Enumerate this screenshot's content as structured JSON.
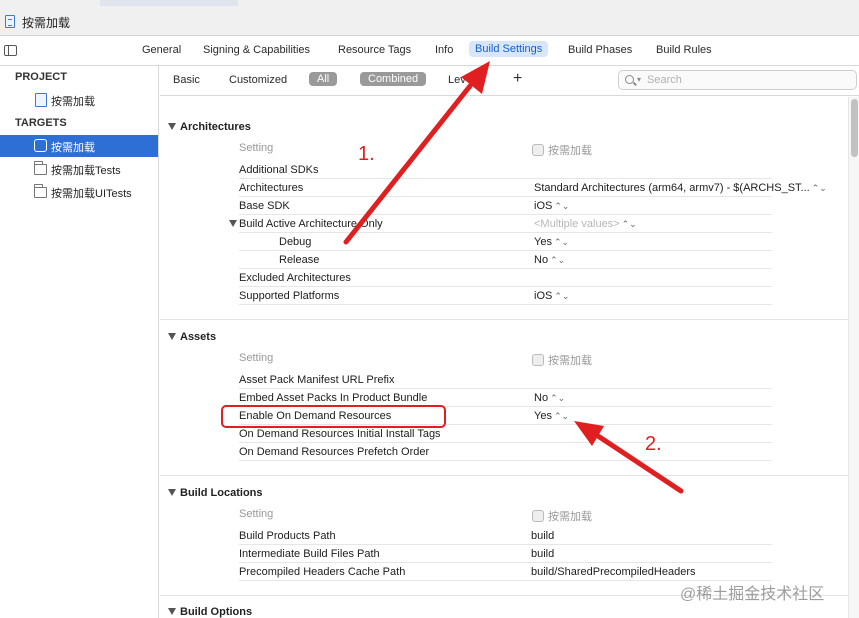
{
  "window": {
    "title": "按需加载"
  },
  "editor_tabs": [
    {
      "label": "General"
    },
    {
      "label": "Signing & Capabilities"
    },
    {
      "label": "Resource Tags"
    },
    {
      "label": "Info"
    },
    {
      "label": "Build Settings"
    },
    {
      "label": "Build Phases"
    },
    {
      "label": "Build Rules"
    }
  ],
  "navigator": {
    "project_header": "PROJECT",
    "project_item": "按需加载",
    "targets_header": "TARGETS",
    "targets": [
      {
        "label": "按需加载"
      },
      {
        "label": "按需加载Tests"
      },
      {
        "label": "按需加载UITests"
      }
    ]
  },
  "filter": {
    "basic": "Basic",
    "customized": "Customized",
    "all": "All",
    "combined": "Combined",
    "levels": "Lev",
    "add": "+",
    "search_placeholder": "Search"
  },
  "table_header": {
    "setting": "Setting",
    "target": "按需加载"
  },
  "sections": [
    {
      "title": "Architectures",
      "rows": [
        {
          "name": "Additional SDKs",
          "value": ""
        },
        {
          "name": "Architectures",
          "value": "Standard Architectures (arm64, armv7)  -  $(ARCHS_ST..."
        },
        {
          "name": "Base SDK",
          "value": "iOS"
        },
        {
          "name": "Build Active Architecture Only",
          "value": "<Multiple values>"
        },
        {
          "name": "Debug",
          "value": "Yes"
        },
        {
          "name": "Release",
          "value": "No"
        },
        {
          "name": "Excluded Architectures",
          "value": ""
        },
        {
          "name": "Supported Platforms",
          "value": "iOS"
        }
      ]
    },
    {
      "title": "Assets",
      "rows": [
        {
          "name": "Asset Pack Manifest URL Prefix",
          "value": ""
        },
        {
          "name": "Embed Asset Packs In Product Bundle",
          "value": "No"
        },
        {
          "name": "Enable On Demand Resources",
          "value": "Yes"
        },
        {
          "name": "On Demand Resources Initial Install Tags",
          "value": ""
        },
        {
          "name": "On Demand Resources Prefetch Order",
          "value": ""
        }
      ]
    },
    {
      "title": "Build Locations",
      "rows": [
        {
          "name": "Build Products Path",
          "value": "build"
        },
        {
          "name": "Intermediate Build Files Path",
          "value": "build"
        },
        {
          "name": "Precompiled Headers Cache Path",
          "value": "build/SharedPrecompiledHeaders"
        }
      ]
    },
    {
      "title": "Build Options",
      "rows": []
    }
  ],
  "annotations": {
    "step1": "1.",
    "step2": "2.",
    "color": "#e02020"
  },
  "watermark": "@稀土掘金技术社区",
  "colors": {
    "accent": "#2e6fd5",
    "tab_active_bg": "#d7e6fb",
    "tab_active_text": "#1460d0"
  }
}
